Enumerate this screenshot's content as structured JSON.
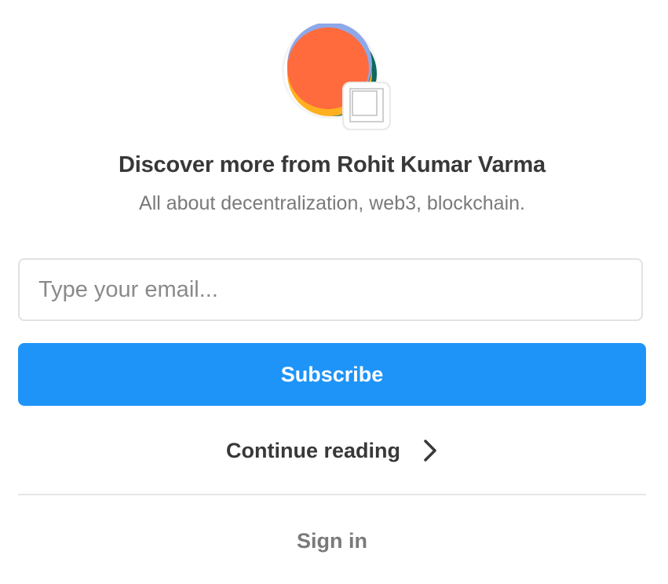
{
  "publication": {
    "logo_icon": "publication-logo-icon",
    "badge_icon": "author-avatar-placeholder-icon"
  },
  "header": {
    "title": "Discover more from Rohit Kumar Varma",
    "subtitle": "All about decentralization, web3, blockchain."
  },
  "form": {
    "email_value": "",
    "email_placeholder": "Type your email...",
    "subscribe_label": "Subscribe"
  },
  "links": {
    "continue_label": "Continue reading",
    "continue_icon": "chevron-right-icon",
    "signin_label": "Sign in"
  },
  "colors": {
    "accent": "#1e94f9",
    "logo_orange": "#ff6b3d",
    "logo_blue": "#8ea8e8",
    "logo_yellow": "#ffb020",
    "logo_teal": "#0b6b5c"
  }
}
